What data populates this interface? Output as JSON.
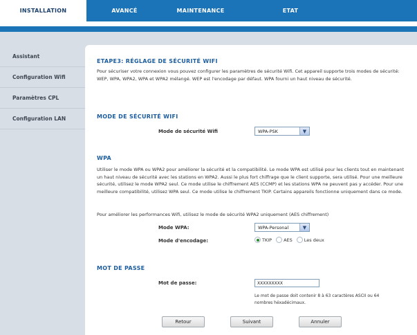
{
  "nav": {
    "tabs": [
      {
        "label": "INSTALLATION"
      },
      {
        "label": "AVANCÉ"
      },
      {
        "label": "MAINTENANCE"
      },
      {
        "label": "ETAT"
      }
    ]
  },
  "sidebar": {
    "items": [
      {
        "label": "Assistant"
      },
      {
        "label": "Configuration Wifi"
      },
      {
        "label": "Paramètres CPL"
      },
      {
        "label": "Configuration LAN"
      }
    ]
  },
  "step": {
    "title": "ETAPE3: RÉGLAGE DE SÉCURITÉ WIFI",
    "intro": "Pour sécuriser votre connexion vous pouvez configurer les paramètres de sécurité Wifi. Cet appareil supporte trois modes de sécurité: WEP, WPA, WPA2, WPA et WPA2 mélangé. WEP est l'encodage par défaut. WPA fourni un haut niveau de sécurité."
  },
  "mode_section": {
    "title": "MODE DE SÉCURITÉ WIFI",
    "label": "Mode de sécurité Wifi",
    "value": "WPA-PSK"
  },
  "wpa_section": {
    "title": "WPA",
    "desc": "Utiliser le mode WPA ou WPA2 pour améliorer la sécurité et la compatibilité. Le mode WPA est utilisé pour les clients tout en maintenant un haut niveau de sécurité avec les stations en WPA2. Aussi le plus fort chiffrage que le client supporte, sera utilisé. Pour une meilleure sécurité, utilisez le mode WPA2 seul. Ce mode utilise le chiffrement AES (CCMP) et les stations WPA ne peuvent pas y accéder. Pour une meilleure compatibilité, utilisez WPA seul. Ce mode utilise le chiffrement TKIP. Certains appareils fonctionne uniquement dans ce mode.",
    "tip": "Pour améliorer les performances Wifi, utilisez le mode de sécurité WPA2 uniquement (AES chiffrement)",
    "mode_label": "Mode WPA:",
    "mode_value": "WPA-Personal",
    "enc_label": "Mode d'encodage:",
    "enc_options": {
      "tkip": "TKIP",
      "aes": "AES",
      "both": "Les deux"
    },
    "enc_selected": "TKIP"
  },
  "pass_section": {
    "title": "MOT DE PASSE",
    "label": "Mot de passe:",
    "value": "XXXXXXXXX",
    "hint": "Le mot de passe doit contenir 8 à 63 caractères ASCII ou 64 nombres héxadécimaux."
  },
  "buttons": {
    "back": "Retour",
    "next": "Suivant",
    "cancel": "Annuler"
  }
}
